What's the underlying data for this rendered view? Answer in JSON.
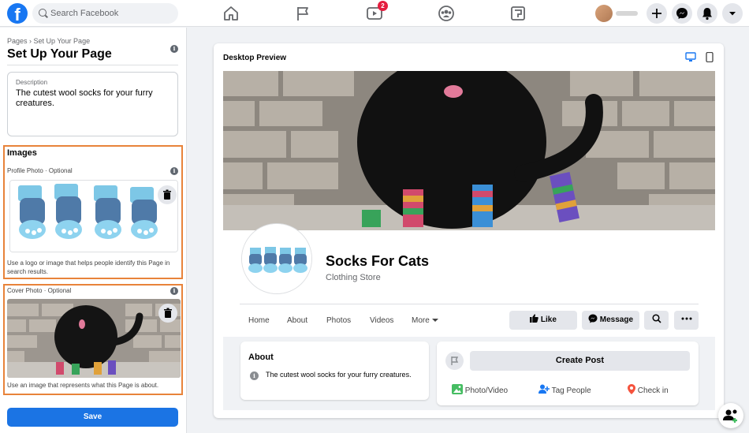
{
  "topbar": {
    "logo_letter": "f",
    "search_placeholder": "Search Facebook",
    "watch_badge": "2"
  },
  "sidebar": {
    "breadcrumb": "Pages › Set Up Your Page",
    "title": "Set Up Your Page",
    "description": {
      "label": "Description",
      "value": "The cutest wool socks for your furry creatures."
    },
    "images": {
      "heading": "Images",
      "profile_label": "Profile Photo · Optional",
      "profile_hint": "Use a logo or image that helps people identify this Page in search results.",
      "cover_label": "Cover Photo · Optional",
      "cover_hint": "Use an image that represents what this Page is about."
    },
    "save_label": "Save"
  },
  "preview": {
    "title": "Desktop Preview",
    "page_name": "Socks For Cats",
    "category": "Clothing Store",
    "tabs": [
      "Home",
      "About",
      "Photos",
      "Videos",
      "More"
    ],
    "actions": {
      "like": "Like",
      "message": "Message"
    },
    "about": {
      "heading": "About",
      "text": "The cutest wool socks for your furry creatures."
    },
    "post": {
      "create": "Create Post",
      "photo_video": "Photo/Video",
      "tag_people": "Tag People",
      "check_in": "Check in"
    }
  },
  "colors": {
    "brand": "#1877f2",
    "highlight_border": "#e8833a",
    "save_button": "#1b74e4",
    "badge": "#e41e3f"
  }
}
